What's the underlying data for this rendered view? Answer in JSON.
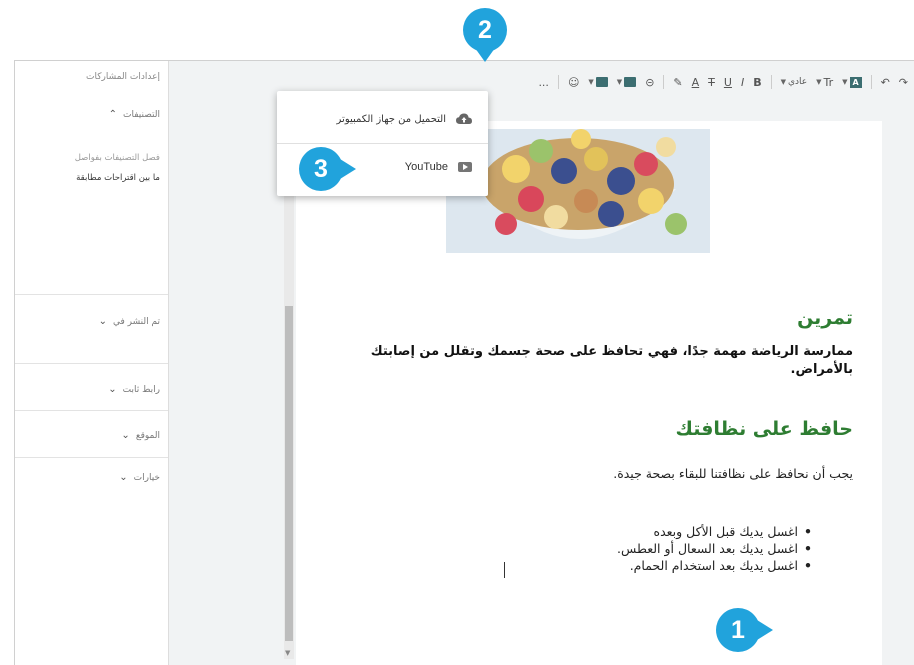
{
  "colors": {
    "accent": "#21a3dc",
    "heading_green": "#2e7d32",
    "toolbar_bg": "#f1f3f4"
  },
  "sidebar": {
    "title": "إعدادات المشاركات",
    "categories_label": "التصنيفات",
    "separator_hint": "فصل التصنيفات بفواصل",
    "categories_value": "ما بين اقتراحات مطابقة",
    "sections": [
      "تم النشر في",
      "رابط ثابت",
      "الموقع",
      "خيارات"
    ]
  },
  "toolbar": {
    "icons": [
      "undo-icon",
      "redo-icon",
      "text-color-icon",
      "font-size-icon",
      "normal-style-dropdown",
      "bold-icon",
      "italic-icon",
      "underline-icon",
      "strikethrough-icon",
      "font-color-icon",
      "highlight-icon",
      "link-icon",
      "insert-image-icon",
      "insert-video-icon",
      "emoji-icon",
      "more-icon"
    ],
    "font_size_label": "Tr",
    "style_label": "عادي",
    "bold": "B",
    "italic": "I",
    "underline": "U",
    "strike": "T",
    "font_color": "A",
    "box_a": "A",
    "more": "..."
  },
  "dropdown": {
    "upload_label": "التحميل من جهاز الكمبيوتر",
    "youtube_label": "YouTube"
  },
  "document": {
    "heading1": "تمرين",
    "para1": "ممارسة الرياضة مهمة جدًا، فهي تحافظ على صحة جسمك وتقلل من إصابتك بالأمراض.",
    "heading2": "حافظ على نظافتك",
    "para2": "يجب أن نحافظ على نظافتنا للبقاء بصحة جيدة.",
    "bullets": [
      "اغسل يديك قبل الأكل وبعده",
      "اغسل يديك بعد السعال أو العطس.",
      "اغسل يديك بعد استخدام الحمام."
    ]
  },
  "callouts": [
    "1",
    "2",
    "3"
  ]
}
